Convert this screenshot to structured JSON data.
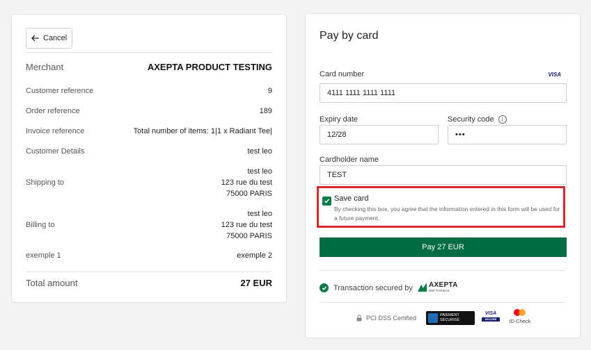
{
  "summary": {
    "cancel_label": "Cancel",
    "merchant_label": "Merchant",
    "merchant_value": "AXEPTA PRODUCT TESTING",
    "customer_ref_label": "Customer reference",
    "customer_ref_value": "9",
    "order_ref_label": "Order reference",
    "order_ref_value": "189",
    "invoice_ref_label": "Invoice reference",
    "invoice_ref_value": "Total number of items: 1|1 x Radiant Tee|",
    "customer_details_label": "Customer Details",
    "customer_details_value": "test leo",
    "shipping_label": "Shipping to",
    "shipping_lines": [
      "test leo",
      "123 rue du test",
      "75000 PARIS"
    ],
    "billing_label": "Billing to",
    "billing_lines": [
      "test leo",
      "123 rue du test",
      "75000 PARIS"
    ],
    "extra_label": "exemple 1",
    "extra_value": "exemple 2",
    "total_label": "Total amount",
    "total_value": "27 EUR"
  },
  "payment": {
    "title": "Pay by card",
    "card_number_label": "Card number",
    "card_brand": "VISA",
    "card_number_value": "4111 1111 1111 1111",
    "expiry_label": "Expiry date",
    "expiry_value": "12/28",
    "security_label": "Security code",
    "security_value": "•••",
    "cardholder_label": "Cardholder name",
    "cardholder_value": "TEST",
    "save_card_title": "Save card",
    "save_card_desc": "By checking this box, you agree that the information entered in this form will be used for a future payment.",
    "save_card_checked": true,
    "pay_button_label": "Pay 27 EUR",
    "secured_text": "Transaction secured by",
    "axepta_name": "AXEPTA",
    "axepta_sub": "BNP PARIBAS",
    "pci_text": "PCI DSS Certified",
    "paiement_badge_line1": "PAIEMENT",
    "paiement_badge_line2": "SÉCURISÉ",
    "visa_badge": "VISA",
    "visa_badge_sub": "SECURE",
    "idcheck_label": "ID Check"
  },
  "colors": {
    "accent_green": "#006c41",
    "highlight_red": "#d9262a"
  }
}
